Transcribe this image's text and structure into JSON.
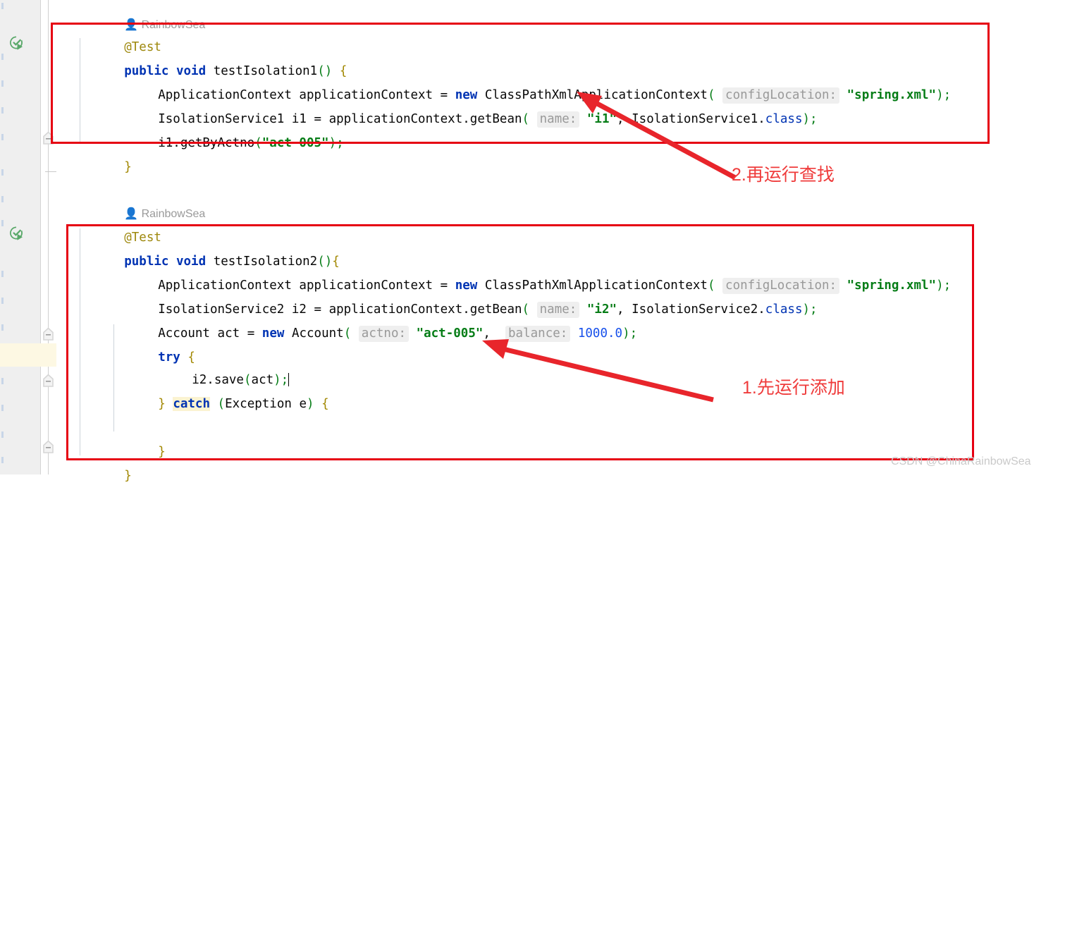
{
  "editor": {
    "gutter": {
      "run_icon_name": "run-test-icon",
      "fold_marker_name": "code-fold-marker"
    },
    "author_label": "RainbowSea",
    "methods": [
      {
        "annotation": "@Test",
        "signature_parts": {
          "modifier": "public",
          "return_type": "void",
          "name": "testIsolation1",
          "params": "()",
          "brace": "{"
        }
      },
      {
        "annotation": "@Test",
        "signature_parts": {
          "modifier": "public",
          "return_type": "void",
          "name": "testIsolation2",
          "params": "()",
          "brace": "{"
        }
      }
    ],
    "block1": {
      "line_annotation": "@Test",
      "line_sig_public": "public",
      "line_sig_void": "void",
      "line_sig_name": "testIsolation1",
      "line_sig_parens": "()",
      "line_sig_brace": "{",
      "l2_type": "ApplicationContext",
      "l2_var": "applicationContext",
      "l2_eq": "=",
      "l2_new": "new",
      "l2_ctor": "ClassPathXmlApplicationContext",
      "l2_open": "(",
      "l2_hint": "configLocation:",
      "l2_str": "\"spring.xml\"",
      "l2_close": ");",
      "l3_type": "IsolationService1",
      "l3_var": "i1",
      "l3_eq": "=",
      "l3_call": "applicationContext.getBean",
      "l3_open": "(",
      "l3_hint": "name:",
      "l3_str": "\"i1\"",
      "l3_comma": ",",
      "l3_arg2": "IsolationService1",
      "l3_dot": ".",
      "l3_class": "class",
      "l3_close": ");",
      "l4_call": "i1.getByActno",
      "l4_open": "(",
      "l4_str": "\"act-005\"",
      "l4_close": ");",
      "l5_brace": "}"
    },
    "block2": {
      "author": "RainbowSea",
      "line_annotation": "@Test",
      "line_sig_public": "public",
      "line_sig_void": "void",
      "line_sig_name": "testIsolation2",
      "line_sig_parens": "()",
      "line_sig_brace": "{",
      "l2_type": "ApplicationContext",
      "l2_var": "applicationContext",
      "l2_eq": "=",
      "l2_new": "new",
      "l2_ctor": "ClassPathXmlApplicationContext",
      "l2_open": "(",
      "l2_hint": "configLocation:",
      "l2_str": "\"spring.xml\"",
      "l2_close": ");",
      "l3_type": "IsolationService2",
      "l3_var": "i2",
      "l3_eq": "=",
      "l3_call": "applicationContext.getBean",
      "l3_open": "(",
      "l3_hint": "name:",
      "l3_str": "\"i2\"",
      "l3_comma": ",",
      "l3_arg2": "IsolationService2",
      "l3_dot": ".",
      "l3_class": "class",
      "l3_close": ");",
      "l4_type": "Account",
      "l4_var": "act",
      "l4_eq": "=",
      "l4_new": "new",
      "l4_ctor": "Account",
      "l4_open": "(",
      "l4_hint1": "actno:",
      "l4_str": "\"act-005\"",
      "l4_comma": ",",
      "l4_hint2": "balance:",
      "l4_num": "1000.0",
      "l4_close": ");",
      "l5_try": "try",
      "l5_brace": "{",
      "l6_call": "i2.save",
      "l6_open": "(",
      "l6_arg": "act",
      "l6_close": ");",
      "l7_closebrace": "}",
      "l7_catch": "catch",
      "l7_open": "(",
      "l7_ex": "Exception",
      "l7_var": "e",
      "l7_close": ")",
      "l7_brace": "{",
      "l8_brace": "}",
      "l9_brace": "}"
    }
  },
  "annotations": {
    "color": "#e60012",
    "label_color": "#ef3b3b",
    "callout_1": "2.再运行查找",
    "callout_2": "1.先运行添加",
    "arrow_1_name": "red-arrow-to-bean-name-i1",
    "arrow_2_name": "red-arrow-to-save-call",
    "box_1_name": "red-highlight-box-test1",
    "box_2_name": "red-highlight-box-test2"
  },
  "watermark": {
    "text": "CSDN @ChinaRainbowSea"
  }
}
